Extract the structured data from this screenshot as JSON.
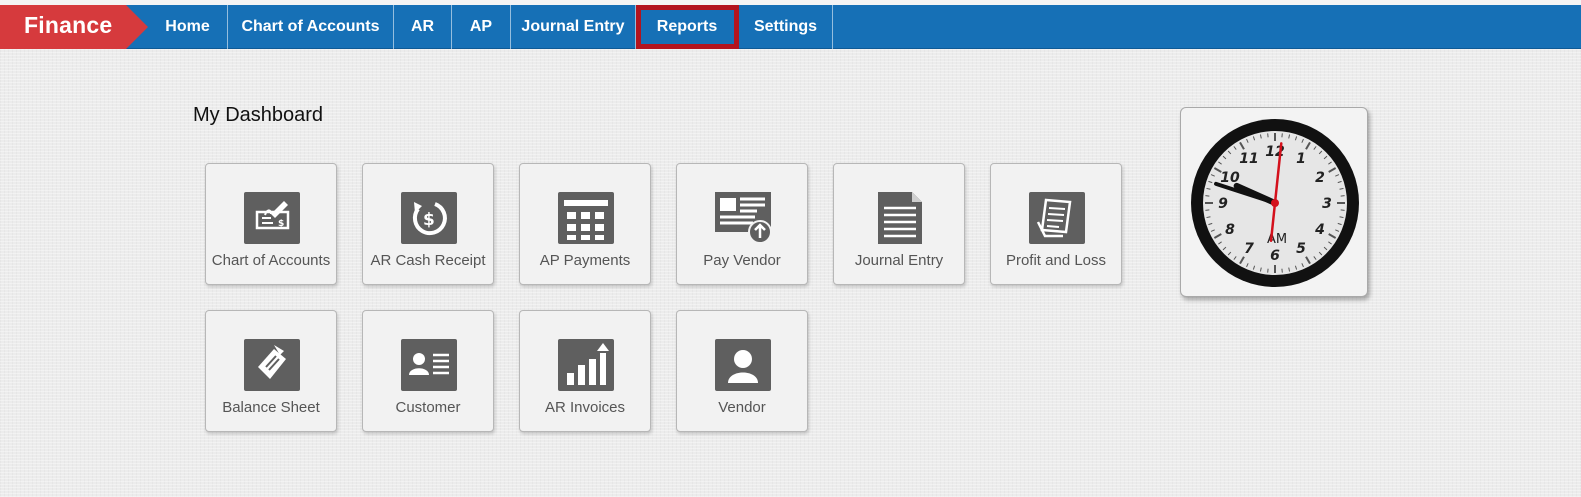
{
  "brand": "Finance",
  "nav": [
    {
      "label": "Home",
      "name": "nav-home"
    },
    {
      "label": "Chart of Accounts",
      "name": "nav-chart-of-accounts"
    },
    {
      "label": "AR",
      "name": "nav-ar"
    },
    {
      "label": "AP",
      "name": "nav-ap"
    },
    {
      "label": "Journal Entry",
      "name": "nav-journal-entry"
    },
    {
      "label": "Reports",
      "name": "nav-reports",
      "active": true
    },
    {
      "label": "Settings",
      "name": "nav-settings"
    }
  ],
  "dashboard": {
    "title": "My Dashboard",
    "tiles": [
      {
        "label": "Chart of Accounts",
        "icon": "check-icon"
      },
      {
        "label": "AR Cash Receipt",
        "icon": "cash-receipt-icon"
      },
      {
        "label": "AP Payments",
        "icon": "grid-table-icon"
      },
      {
        "label": "Pay Vendor",
        "icon": "pay-vendor-icon"
      },
      {
        "label": "Journal Entry",
        "icon": "document-icon"
      },
      {
        "label": "Profit and Loss",
        "icon": "ledger-icon"
      },
      {
        "label": "Balance Sheet",
        "icon": "balance-sheet-icon"
      },
      {
        "label": "Customer",
        "icon": "contact-card-icon"
      },
      {
        "label": "AR Invoices",
        "icon": "bar-chart-up-icon"
      },
      {
        "label": "Vendor",
        "icon": "person-icon"
      }
    ]
  },
  "clock": {
    "period": "AM",
    "hour": 9,
    "minute": 48,
    "second": 1,
    "numerals": [
      "12",
      "1",
      "2",
      "3",
      "4",
      "5",
      "6",
      "7",
      "8",
      "9",
      "10",
      "11"
    ]
  },
  "colors": {
    "nav_bg": "#1670b6",
    "brand_bg": "#d63a3d",
    "active_outline": "#b3141e",
    "icon_bg": "#5f5f5f",
    "second_hand": "#d4111c"
  }
}
